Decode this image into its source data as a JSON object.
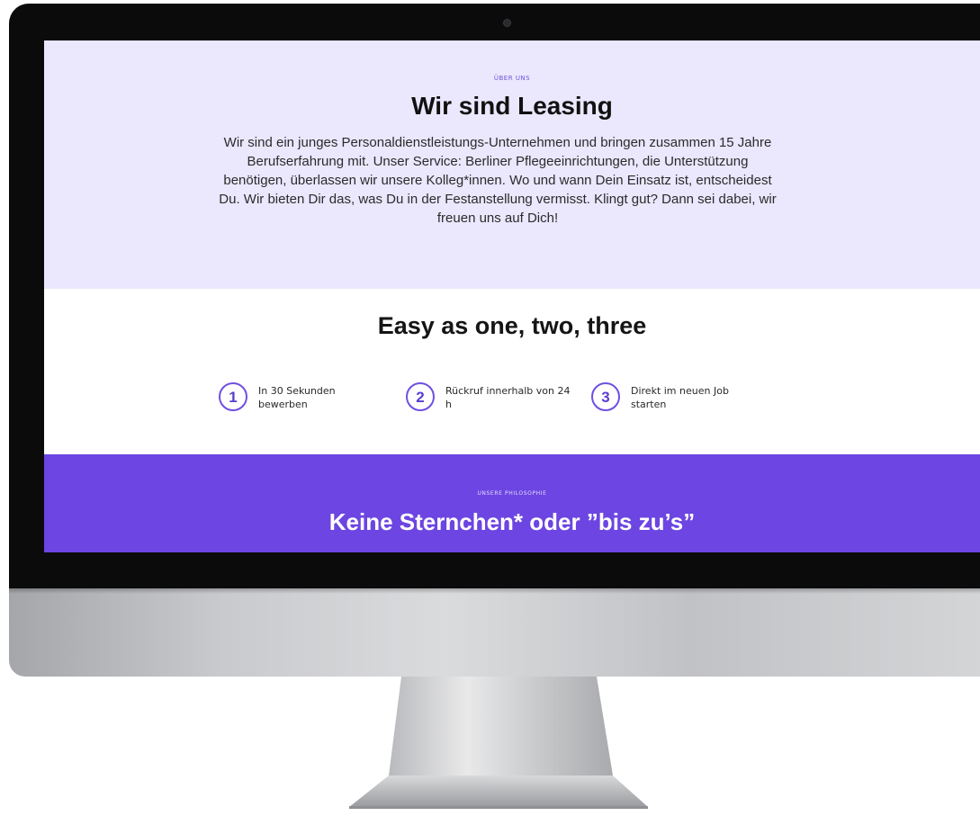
{
  "about": {
    "eyebrow": "ÜBER UNS",
    "title": "Wir sind Leasing",
    "text": "Wir sind ein junges Personaldienstleistungs-Unternehmen und bringen zusammen 15 Jahre Berufserfahrung mit. Unser Service: Berliner Pflegeeinrichtungen, die Unterstützung benötigen, überlassen wir unsere Kolleg*innen. Wo und wann Dein Einsatz ist, entscheidest Du. Wir bieten Dir das, was Du in der Festanstellung vermisst. Klingt gut? Dann sei dabei, wir freuen uns auf Dich!"
  },
  "steps": {
    "title": "Easy as one, two, three",
    "items": [
      {
        "number": "1",
        "label": "In 30 Sekunden bewerben"
      },
      {
        "number": "2",
        "label": "Rückruf innerhalb von 24 h"
      },
      {
        "number": "3",
        "label": "Direkt im neuen Job starten"
      }
    ]
  },
  "philosophy": {
    "eyebrow": "UNSERE PHILOSOPHIE",
    "title": "Keine Sternchen* oder ”bis zu’s”"
  },
  "colors": {
    "lavender_bg": "#ebe7fd",
    "accent_purple": "#6c45e2",
    "circle_stroke": "#6f4fe2"
  }
}
